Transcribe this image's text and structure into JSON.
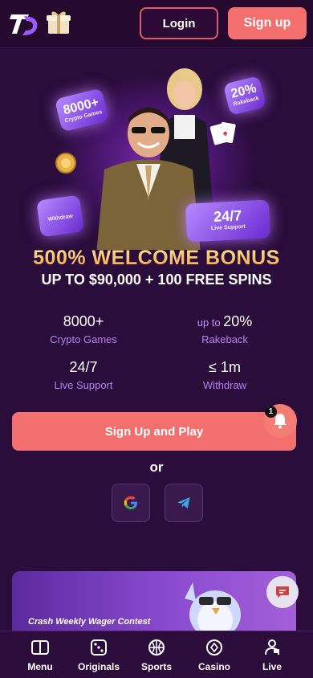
{
  "header": {
    "login_label": "Login",
    "signup_label": "Sign up"
  },
  "hero_cards": {
    "games_value": "8000+",
    "games_caption": "Crypto Games",
    "rakeback_value": "20%",
    "rakeback_caption": "Rakeback",
    "support_value": "24/7",
    "support_caption": "Live Support",
    "withdraw_caption": "Withdraw"
  },
  "promo": {
    "title": "500% WELCOME BONUS",
    "subtitle": "UP TO $90,000 + 100 FREE SPINS"
  },
  "stats": [
    {
      "prefix": "",
      "value": "8000+",
      "label": "Crypto Games"
    },
    {
      "prefix": "up to ",
      "value": "20%",
      "label": "Rakeback"
    },
    {
      "prefix": "",
      "value": "24/7",
      "label": "Live Support"
    },
    {
      "prefix": "",
      "value": "≤ 1m",
      "label": "Withdraw"
    }
  ],
  "cta": {
    "label": "Sign Up and Play",
    "notification_count": "1"
  },
  "or_label": "or",
  "banner": {
    "title": "Crash Weekly Wager Contest"
  },
  "nav": [
    {
      "label": "Menu",
      "icon": "menu-icon"
    },
    {
      "label": "Originals",
      "icon": "dice-icon"
    },
    {
      "label": "Sports",
      "icon": "basketball-icon"
    },
    {
      "label": "Casino",
      "icon": "casino-chip-icon"
    },
    {
      "label": "Live",
      "icon": "live-dealer-icon"
    }
  ],
  "colors": {
    "accent": "#f4706f",
    "background": "#2a0d3b",
    "stat_label": "#b57ef2",
    "gold": "#f3a33c"
  }
}
